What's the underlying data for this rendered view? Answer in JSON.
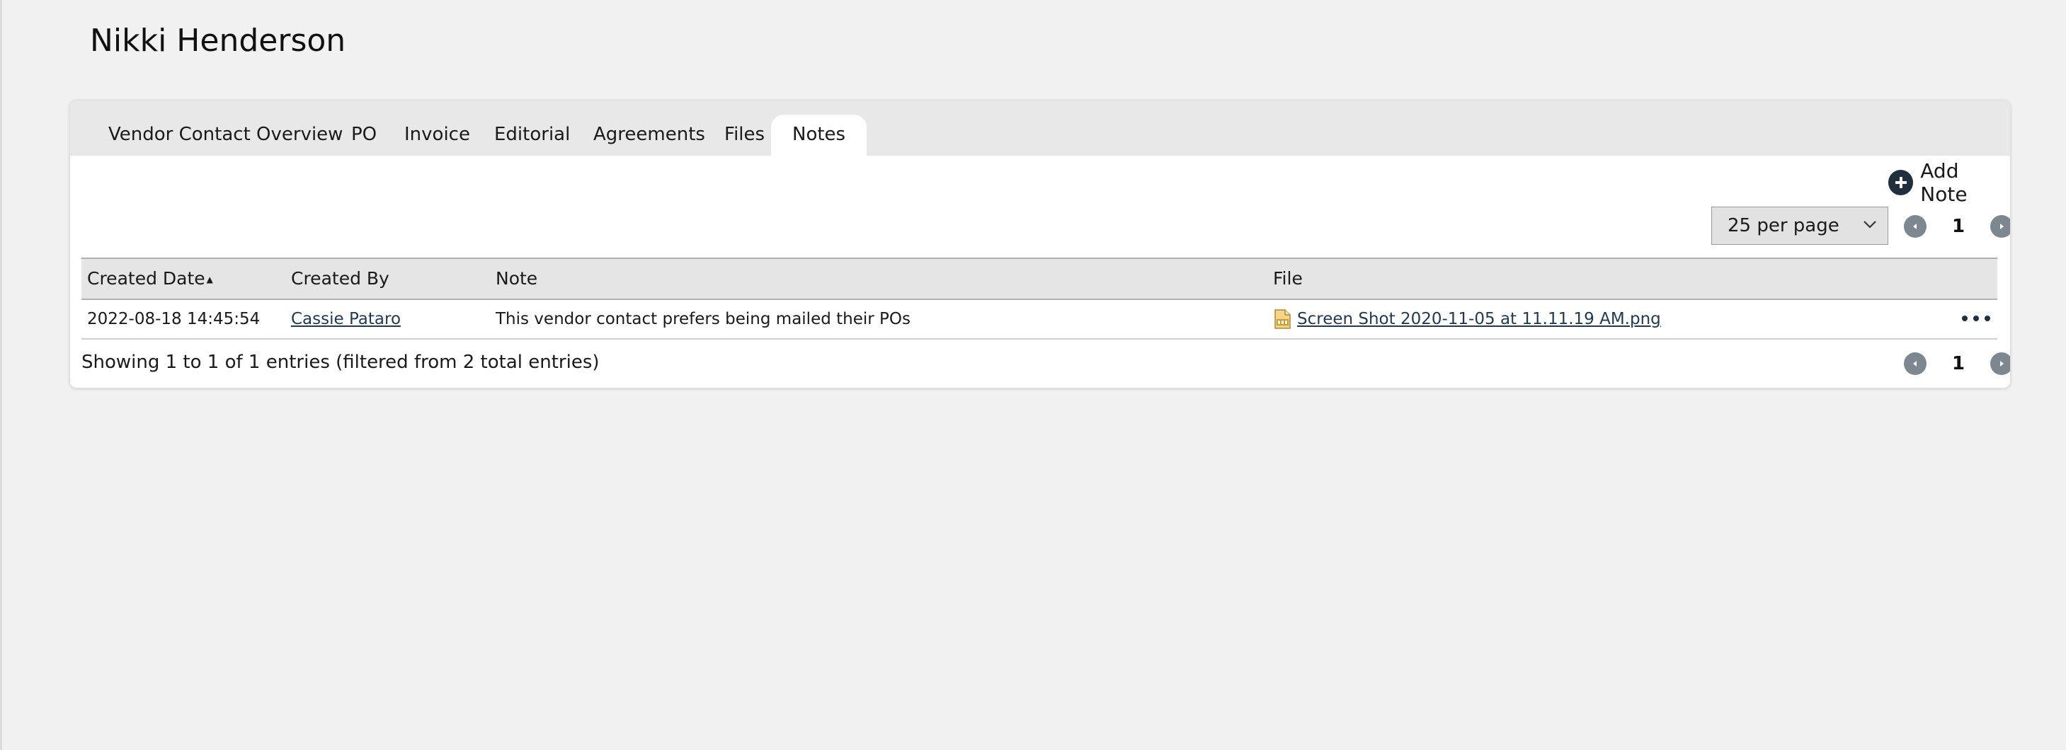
{
  "page": {
    "title": "Nikki Henderson"
  },
  "tabs": [
    {
      "label": "Vendor Contact Overview"
    },
    {
      "label": "PO"
    },
    {
      "label": "Invoice"
    },
    {
      "label": "Editorial"
    },
    {
      "label": "Agreements"
    },
    {
      "label": "Files"
    },
    {
      "label": "Notes",
      "active": true
    }
  ],
  "toolbar": {
    "add_note_label": "Add Note",
    "add_note_icon": "plus-circle-icon",
    "per_page_value": "25 per page"
  },
  "pagination": {
    "current_page": "1",
    "prev_icon": "chevron-left-circle-icon",
    "next_icon": "chevron-right-circle-icon"
  },
  "table": {
    "columns": [
      "Created Date",
      "Created By",
      "Note",
      "File"
    ],
    "sorted_column": "Created Date",
    "sort_direction": "ascending",
    "rows": [
      {
        "created_date": "2022-08-18 14:45:54",
        "created_by": "Cassie Pataro",
        "note": "This vendor contact prefers being mailed their POs",
        "file": "Screen Shot 2020-11-05 at 11.11.19 AM.png",
        "file_icon": "png-file-icon",
        "actions_icon": "more-horizontal-icon"
      }
    ]
  },
  "footer": {
    "info": "Showing 1 to 1 of 1 entries (filtered from 2 total entries)"
  },
  "colors": {
    "background": "#f1f1f1",
    "tabbar": "#e8e8e8",
    "accent_dark": "#1f2f3d",
    "link": "#1f3a56",
    "pager_button": "#7d8790"
  }
}
